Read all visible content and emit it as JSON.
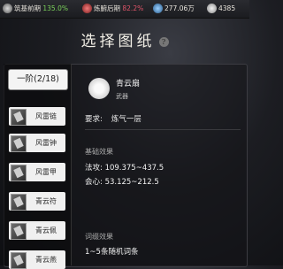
{
  "topbar": {
    "realm": "筑基前期",
    "realm_pct": "135.0%",
    "alchemy": "炼腑后期",
    "alchemy_pct": "82.2%",
    "stones": "277.06万",
    "currency": "4385",
    "icons": [
      "realm-icon",
      "alchemy-icon",
      "spirit-stone-icon",
      "coin-icon"
    ],
    "colors": {
      "positive": "#7bd25a",
      "negative": "#e0556a"
    }
  },
  "page": {
    "title": "选择图纸",
    "help": "?"
  },
  "sidebar": {
    "tier_tab": "一阶(2/18)",
    "items": [
      {
        "label": "风雷链"
      },
      {
        "label": "风雷钟"
      },
      {
        "label": "风雷甲"
      },
      {
        "label": "青云符"
      },
      {
        "label": "青云佩"
      },
      {
        "label": "青云燕"
      }
    ]
  },
  "detail": {
    "name": "青云扇",
    "type": "武器",
    "requirement_label": "要求:",
    "requirement_value": "炼气一层",
    "base_label": "基础效果",
    "stats": [
      {
        "text": "法攻: 109.375~437.5"
      },
      {
        "text": "会心: 53.125~212.5"
      }
    ],
    "lexicon_label": "词缀效果",
    "lexicon_value": "1~5条随机词条"
  }
}
